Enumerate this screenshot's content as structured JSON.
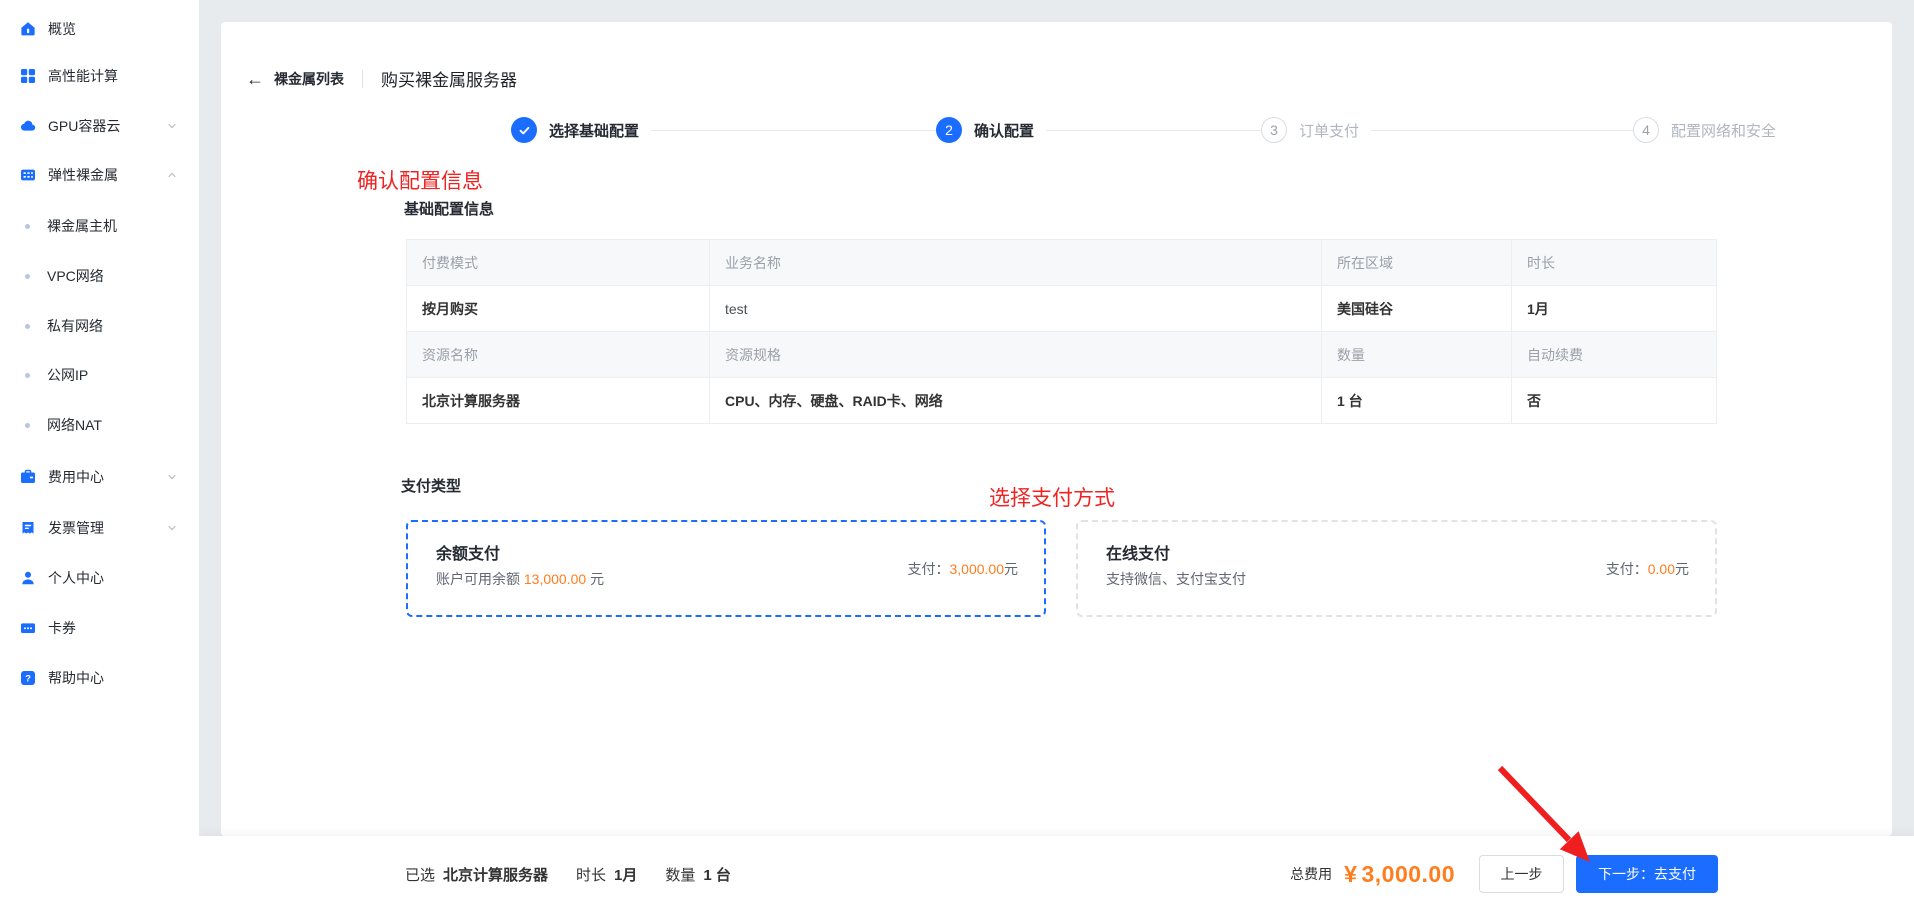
{
  "colors": {
    "accent": "#1b6dff",
    "orange": "#ff7d1e",
    "red": "#f02323",
    "sidebar_bg": "#ffffff",
    "content_bg": "#e8ebee"
  },
  "sidebar": {
    "items": [
      {
        "label": "概览",
        "icon": "home-icon"
      },
      {
        "label": "高性能计算",
        "icon": "grid-icon"
      },
      {
        "label": "GPU容器云",
        "icon": "cloud-icon",
        "chevron": "down"
      },
      {
        "label": "弹性裸金属",
        "icon": "server-icon",
        "chevron": "up"
      },
      {
        "label": "裸金属主机",
        "type": "sub"
      },
      {
        "label": "VPC网络",
        "type": "sub"
      },
      {
        "label": "私有网络",
        "type": "sub"
      },
      {
        "label": "公网IP",
        "type": "sub"
      },
      {
        "label": "网络NAT",
        "type": "sub"
      },
      {
        "label": "费用中心",
        "icon": "wallet-icon",
        "chevron": "down"
      },
      {
        "label": "发票管理",
        "icon": "invoice-icon",
        "chevron": "down"
      },
      {
        "label": "个人中心",
        "icon": "user-icon"
      },
      {
        "label": "卡券",
        "icon": "card-icon"
      },
      {
        "label": "帮助中心",
        "icon": "help-icon"
      }
    ]
  },
  "header": {
    "back_label": "裸金属列表",
    "title": "购买裸金属服务器"
  },
  "steps": [
    {
      "num": "1",
      "label": "选择基础配置",
      "state": "done"
    },
    {
      "num": "2",
      "label": "确认配置",
      "state": "active"
    },
    {
      "num": "3",
      "label": "订单支付",
      "state": "todo"
    },
    {
      "num": "4",
      "label": "配置网络和安全",
      "state": "todo"
    }
  ],
  "annotations": {
    "confirm": "确认配置信息",
    "select_payment": "选择支付方式"
  },
  "config_section": {
    "title": "基础配置信息",
    "header1": [
      "付费模式",
      "业务名称",
      "所在区域",
      "时长"
    ],
    "row1": [
      "按月购买",
      "test",
      "美国硅谷",
      "1月"
    ],
    "header2": [
      "资源名称",
      "资源规格",
      "数量",
      "自动续费"
    ],
    "row2": [
      "北京计算服务器",
      "CPU、内存、硬盘、RAID卡、网络",
      "1 台",
      "否"
    ]
  },
  "payment_section": {
    "title": "支付类型",
    "options": [
      {
        "title": "余额支付",
        "desc_prefix": "账户可用余额 ",
        "desc_amount": "13,000.00",
        "desc_suffix": " 元",
        "pay_label": "支付：",
        "pay_amount": "3,000.00",
        "pay_suffix": " 元",
        "selected": true
      },
      {
        "title": "在线支付",
        "desc_prefix": "支持微信、支付宝支付",
        "desc_amount": "",
        "desc_suffix": "",
        "pay_label": "支付：",
        "pay_amount": "0.00",
        "pay_suffix": " 元",
        "selected": false
      }
    ]
  },
  "footer": {
    "selected_label": "已选",
    "selected_value": "北京计算服务器",
    "duration_label": "时长",
    "duration_value": "1月",
    "qty_label": "数量",
    "qty_value": "1 台",
    "total_label": "总费用",
    "currency": "¥",
    "total_value": "3,000.00",
    "prev_button": "上一步",
    "next_button": "下一步：去支付"
  }
}
